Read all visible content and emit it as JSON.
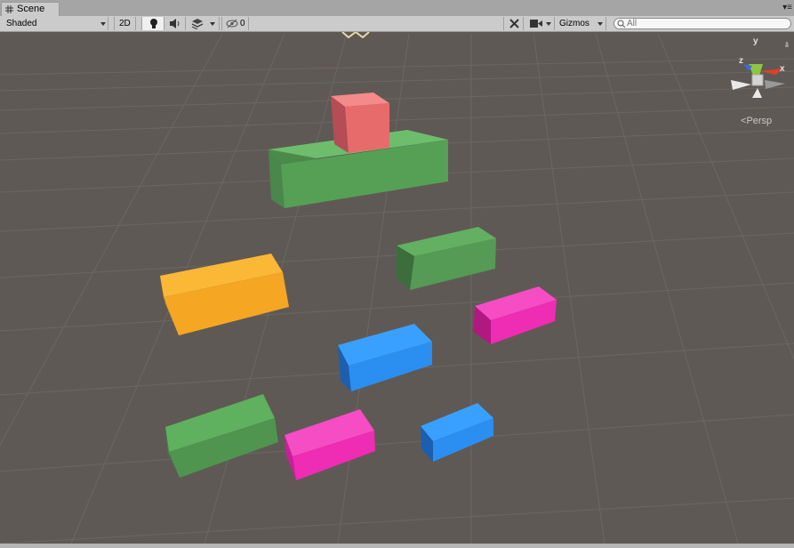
{
  "tab": {
    "title": "Scene",
    "icon": "grid-icon"
  },
  "toolbar": {
    "shading_mode": "Shaded",
    "mode_2d": "2D",
    "lighting_icon": "lightbulb-icon",
    "audio_icon": "speaker-icon",
    "effects_icon": "effects-icon",
    "hidden_icon": "eye-slash-icon",
    "hidden_count": "0",
    "tools_icon": "tools-icon",
    "camera_icon": "camera-icon",
    "gizmos_label": "Gizmos",
    "search_placeholder": "All"
  },
  "gizmo": {
    "y_label": "y",
    "x_label": "x",
    "z_label": "z",
    "projection": "Persp",
    "colors": {
      "x": "#e0402a",
      "y": "#8dc640",
      "z": "#3a6cd8"
    }
  },
  "scene": {
    "background": "#5f5955",
    "objects": [
      {
        "name": "red-cube",
        "color": "#e86b6b"
      },
      {
        "name": "green-platform-top",
        "color": "#5aa95a"
      },
      {
        "name": "green-block-right",
        "color": "#559a55"
      },
      {
        "name": "orange-block",
        "color": "#f7a928"
      },
      {
        "name": "magenta-block-right",
        "color": "#ee2cb4"
      },
      {
        "name": "blue-block-center",
        "color": "#2a8ff0"
      },
      {
        "name": "green-block-bottom",
        "color": "#569d56"
      },
      {
        "name": "magenta-block-bottom",
        "color": "#ee2cb4"
      },
      {
        "name": "blue-block-small",
        "color": "#2a8ff0"
      }
    ]
  }
}
